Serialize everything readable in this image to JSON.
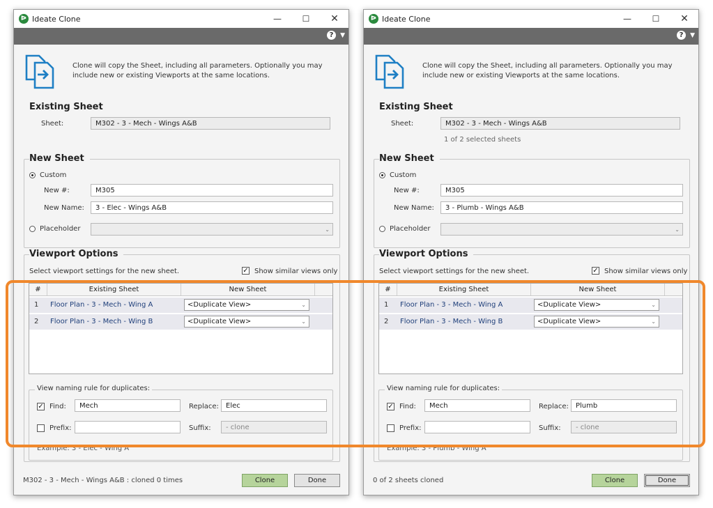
{
  "windows": [
    {
      "title": "Ideate Clone",
      "intro": "Clone will copy the Sheet, including all parameters. Optionally you may include new or existing Viewports at the same locations.",
      "existing_sheet": {
        "heading": "Existing Sheet",
        "sheet_label": "Sheet:",
        "sheet_value": "M302 - 3 - Mech - Wings A&B",
        "selection_note": ""
      },
      "new_sheet": {
        "heading": "New Sheet",
        "custom_label": "Custom",
        "custom_selected": true,
        "number_label": "New #:",
        "number_value": "M305",
        "name_label": "New Name:",
        "name_value": "3 - Elec - Wings A&B",
        "placeholder_label": "Placeholder"
      },
      "viewport_options": {
        "heading": "Viewport Options",
        "instruction": "Select viewport settings for the new sheet.",
        "show_similar_label": "Show similar views only",
        "show_similar_checked": true,
        "columns": [
          "#",
          "Existing Sheet",
          "New Sheet"
        ],
        "rows": [
          {
            "num": "1",
            "existing": "Floor Plan - 3 - Mech - Wing A",
            "new": "<Duplicate View>"
          },
          {
            "num": "2",
            "existing": "Floor Plan - 3 - Mech - Wing B",
            "new": "<Duplicate View>"
          }
        ]
      },
      "naming": {
        "heading": "View naming rule for duplicates:",
        "find_label": "Find:",
        "find_checked": true,
        "find_value": "Mech",
        "replace_label": "Replace:",
        "replace_value": "Elec",
        "prefix_label": "Prefix:",
        "prefix_checked": false,
        "prefix_value": "",
        "suffix_label": "Suffix:",
        "suffix_placeholder": "- clone",
        "example_text": "Example:    3 - Elec - Wing A"
      },
      "status": "M302 - 3 - Mech - Wings A&B  :  cloned 0 times",
      "clone_button": "Clone",
      "done_button": "Done"
    },
    {
      "title": "Ideate Clone",
      "intro": "Clone will copy the Sheet, including all parameters. Optionally you may include new or existing Viewports at the same locations.",
      "existing_sheet": {
        "heading": "Existing Sheet",
        "sheet_label": "Sheet:",
        "sheet_value": "M302 - 3 - Mech - Wings A&B",
        "selection_note": "1 of 2 selected sheets"
      },
      "new_sheet": {
        "heading": "New Sheet",
        "custom_label": "Custom",
        "custom_selected": true,
        "number_label": "New #:",
        "number_value": "M305",
        "name_label": "New Name:",
        "name_value": "3 - Plumb - Wings A&B",
        "placeholder_label": "Placeholder"
      },
      "viewport_options": {
        "heading": "Viewport Options",
        "instruction": "Select viewport settings for the new sheet.",
        "show_similar_label": "Show similar views only",
        "show_similar_checked": true,
        "columns": [
          "#",
          "Existing Sheet",
          "New Sheet"
        ],
        "rows": [
          {
            "num": "1",
            "existing": "Floor Plan - 3 - Mech - Wing A",
            "new": "<Duplicate View>"
          },
          {
            "num": "2",
            "existing": "Floor Plan - 3 - Mech - Wing B",
            "new": "<Duplicate View>"
          }
        ]
      },
      "naming": {
        "heading": "View naming rule for duplicates:",
        "find_label": "Find:",
        "find_checked": true,
        "find_value": "Mech",
        "replace_label": "Replace:",
        "replace_value": "Plumb",
        "prefix_label": "Prefix:",
        "prefix_checked": false,
        "prefix_value": "",
        "suffix_label": "Suffix:",
        "suffix_placeholder": "- clone",
        "example_text": "Example:    3 - Plumb - Wing A"
      },
      "status": "0 of 2 sheets cloned",
      "clone_button": "Clone",
      "done_button": "Done"
    }
  ],
  "colors": {
    "highlight": "#f0882c",
    "clone_button": "#b6d49b",
    "link_text": "#1f3f7a",
    "help_bar": "#6a6a6a"
  }
}
